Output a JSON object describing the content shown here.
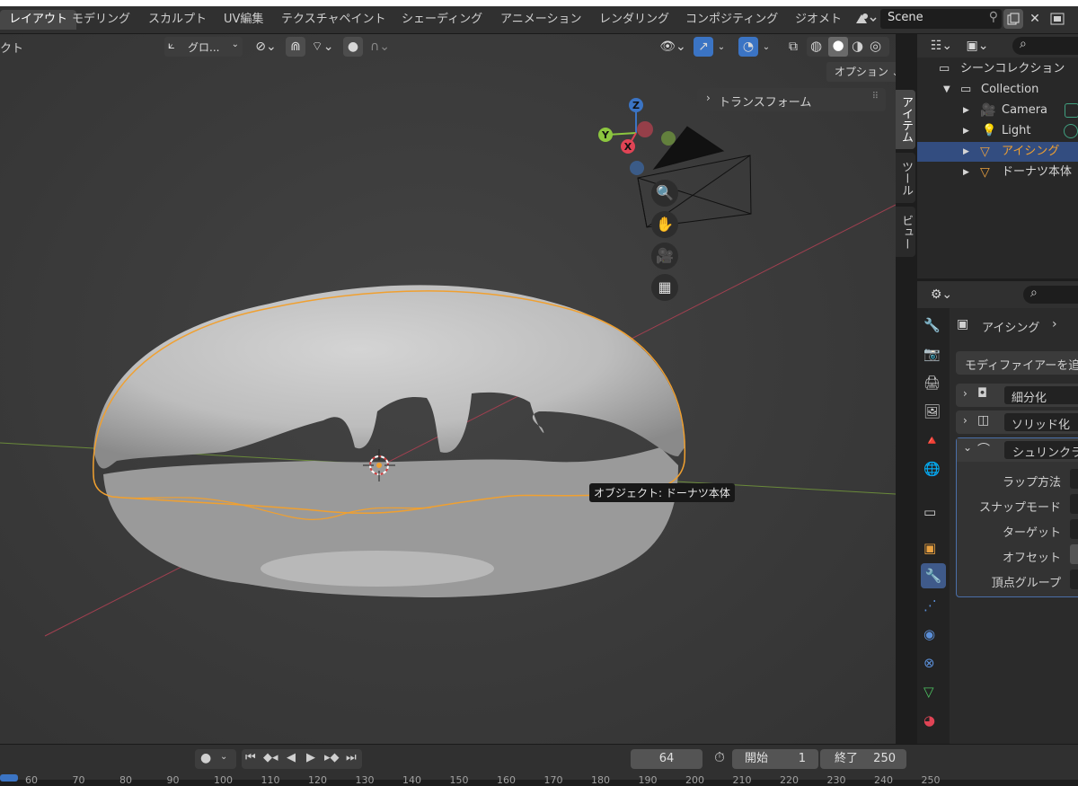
{
  "workspace_tabs": [
    "レイアウト",
    "モデリング",
    "スカルプト",
    "UV編集",
    "テクスチャペイント",
    "シェーディング",
    "アニメーション",
    "レンダリング",
    "コンポジティング",
    "ジオメト"
  ],
  "active_tab": "レイアウト",
  "scene": {
    "name": "Scene"
  },
  "viewport": {
    "mode_label": "クト",
    "transform_orientation": "グロ...",
    "options_label": "オプション",
    "transform_panel_label": "トランスフォーム",
    "sidebar_tabs": [
      "アイテム",
      "ツール",
      "ビュー"
    ],
    "tooltip": "オブジェクト: ドーナツ本体",
    "gizmo": {
      "x": "X",
      "y": "Y",
      "z": "Z"
    }
  },
  "outliner": {
    "scene_collection": "シーンコレクション",
    "collection": "Collection",
    "items": [
      "Camera",
      "Light",
      "アイシング",
      "ドーナツ本体"
    ],
    "selected": "アイシング"
  },
  "properties": {
    "object_name": "アイシング",
    "add_modifier": "モディファイアーを追加",
    "modifiers": [
      "細分化",
      "ソリッド化",
      "シュリンクラ"
    ],
    "shrinkwrap_fields": [
      "ラップ方法",
      "スナップモード",
      "ターゲット",
      "オフセット",
      "頂点グループ"
    ]
  },
  "timeline": {
    "current_frame": "64",
    "start_label": "開始",
    "start_value": "1",
    "end_label": "終了",
    "end_value": "250",
    "ticks": [
      "60",
      "70",
      "80",
      "90",
      "100",
      "110",
      "120",
      "130",
      "140",
      "150",
      "160",
      "170",
      "180",
      "190",
      "200",
      "210",
      "220",
      "230",
      "240",
      "250"
    ]
  },
  "colors": {
    "selection_outline": "#f0a030",
    "active_row": "#334d80",
    "axis_x": "#e04455",
    "axis_y": "#8cc63f",
    "axis_z": "#3b74c4"
  }
}
